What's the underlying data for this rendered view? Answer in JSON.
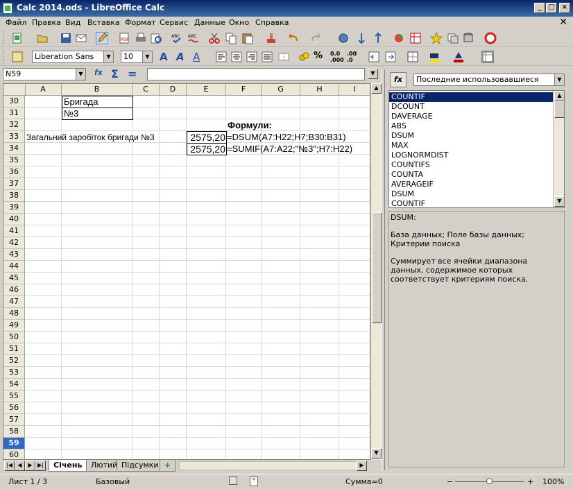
{
  "window": {
    "title": "Calc 2014.ods - LibreOffice Calc"
  },
  "menu": [
    "Файл",
    "Правка",
    "Вид",
    "Вставка",
    "Формат",
    "Сервис",
    "Данные",
    "Окно",
    "Справка"
  ],
  "format_toolbar": {
    "font_name": "Liberation Sans",
    "font_size": "10"
  },
  "formula_bar": {
    "name_box": "N59",
    "input": ""
  },
  "columns": [
    "A",
    "B",
    "C",
    "D",
    "E",
    "F",
    "G",
    "H",
    "I"
  ],
  "rows": [
    "30",
    "31",
    "32",
    "33",
    "34",
    "35",
    "36",
    "37",
    "38",
    "39",
    "40",
    "41",
    "42",
    "43",
    "44",
    "45",
    "46",
    "47",
    "48",
    "49",
    "50",
    "51",
    "52",
    "53",
    "54",
    "55",
    "56",
    "57",
    "58",
    "59",
    "60"
  ],
  "active_row": "59",
  "cells": {
    "b30": "Бригада",
    "b31": "№3",
    "f32": "Формули:",
    "a33": "Загальний заробіток бригади №3",
    "e33": "2575,20",
    "f33": "=DSUM(A7:H22;H7;B30:B31)",
    "e34": "2575,20",
    "f34": "=SUMIF(A7:A22;\"№3\";H7:H22)"
  },
  "sheet_tabs": [
    "Січень",
    "Лютий",
    "Підсумки"
  ],
  "active_tab": "Січень",
  "status": {
    "sheet": "Лист 1 / 3",
    "style": "Базовый",
    "sum": "Сумма=0",
    "zoom": "100%"
  },
  "sidebar": {
    "category": "Последние использовавшиеся",
    "functions": [
      "COUNTIF",
      "DCOUNT",
      "DAVERAGE",
      "ABS",
      "DSUM",
      "MAX",
      "LOGNORMDIST",
      "COUNTIFS",
      "COUNTA",
      "AVERAGEIF",
      "DSUM",
      "COUNTIF"
    ],
    "selected_function": "COUNTIF",
    "desc_name": "DSUM:",
    "desc_args": "База данных; Поле базы данных; Критерии поиска",
    "desc_text": "Суммирует все ячейки диапазона данных, содержимое которых соответствует критериям поиска."
  }
}
